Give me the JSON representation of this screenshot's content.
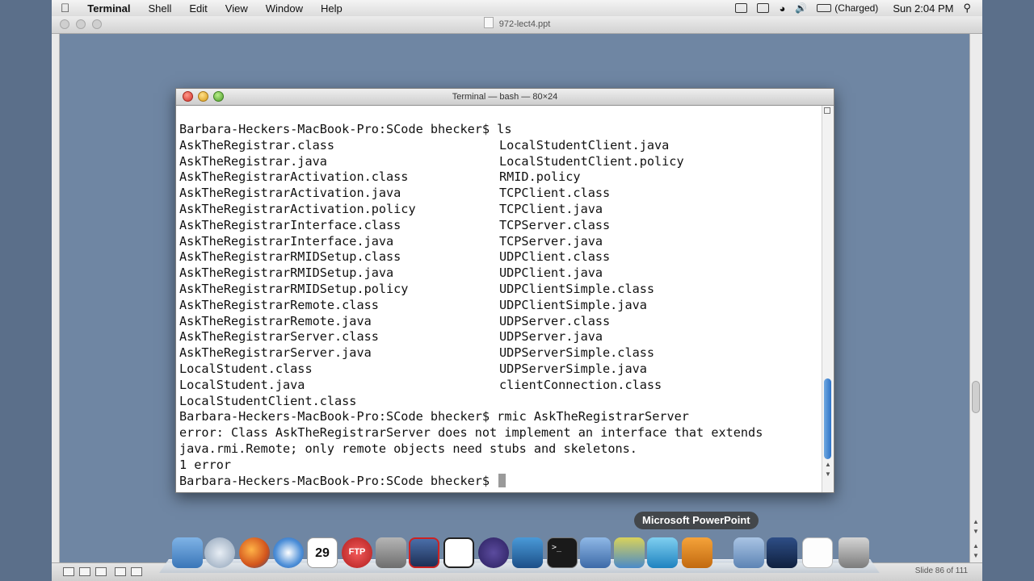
{
  "menubar": {
    "app_name": "Terminal",
    "items": [
      "Shell",
      "Edit",
      "View",
      "Window",
      "Help"
    ],
    "battery_status": "(Charged)",
    "clock": "Sun 2:04 PM"
  },
  "ppt_window": {
    "title": "972-lect4.ppt",
    "slide_counter": "Slide 86 of 111"
  },
  "terminal": {
    "title": "Terminal — bash — 80×24",
    "lines": [
      {
        "c1": "Barbara-Heckers-MacBook-Pro:SCode bhecker$ ls",
        "c2": ""
      },
      {
        "c1": "AskTheRegistrar.class",
        "c2": "LocalStudentClient.java"
      },
      {
        "c1": "AskTheRegistrar.java",
        "c2": "LocalStudentClient.policy"
      },
      {
        "c1": "AskTheRegistrarActivation.class",
        "c2": "RMID.policy"
      },
      {
        "c1": "AskTheRegistrarActivation.java",
        "c2": "TCPClient.class"
      },
      {
        "c1": "AskTheRegistrarActivation.policy",
        "c2": "TCPClient.java"
      },
      {
        "c1": "AskTheRegistrarInterface.class",
        "c2": "TCPServer.class"
      },
      {
        "c1": "AskTheRegistrarInterface.java",
        "c2": "TCPServer.java"
      },
      {
        "c1": "AskTheRegistrarRMIDSetup.class",
        "c2": "UDPClient.class"
      },
      {
        "c1": "AskTheRegistrarRMIDSetup.java",
        "c2": "UDPClient.java"
      },
      {
        "c1": "AskTheRegistrarRMIDSetup.policy",
        "c2": "UDPClientSimple.class"
      },
      {
        "c1": "AskTheRegistrarRemote.class",
        "c2": "UDPClientSimple.java"
      },
      {
        "c1": "AskTheRegistrarRemote.java",
        "c2": "UDPServer.class"
      },
      {
        "c1": "AskTheRegistrarServer.class",
        "c2": "UDPServer.java"
      },
      {
        "c1": "AskTheRegistrarServer.java",
        "c2": "UDPServerSimple.class"
      },
      {
        "c1": "LocalStudent.class",
        "c2": "UDPServerSimple.java"
      },
      {
        "c1": "LocalStudent.java",
        "c2": "clientConnection.class"
      },
      {
        "c1": "LocalStudentClient.class",
        "c2": ""
      },
      {
        "c1": "Barbara-Heckers-MacBook-Pro:SCode bhecker$ rmic AskTheRegistrarServer",
        "c2": ""
      },
      {
        "c1": "error: Class AskTheRegistrarServer does not implement an interface that extends",
        "c2": ""
      },
      {
        "c1": "java.rmi.Remote; only remote objects need stubs and skeletons.",
        "c2": ""
      },
      {
        "c1": "1 error",
        "c2": ""
      }
    ],
    "prompt": "Barbara-Heckers-MacBook-Pro:SCode bhecker$ "
  },
  "dock": {
    "tooltip": "Microsoft PowerPoint",
    "calendar_day": "29",
    "ftp_label": "FTP",
    "icons": [
      "finder-icon",
      "mail-icon",
      "firefox-icon",
      "safari-icon",
      "ical-icon",
      "ftp-icon",
      "system-preferences-icon",
      "rmi-app-icon",
      "grab-icon",
      "eclipse-icon",
      "filmstrip-icon",
      "terminal-icon",
      "xcode-icon",
      "word-icon",
      "msn-icon",
      "powerpoint-icon",
      "applications-folder-icon",
      "network-icon",
      "document-icon",
      "trash-icon"
    ]
  }
}
